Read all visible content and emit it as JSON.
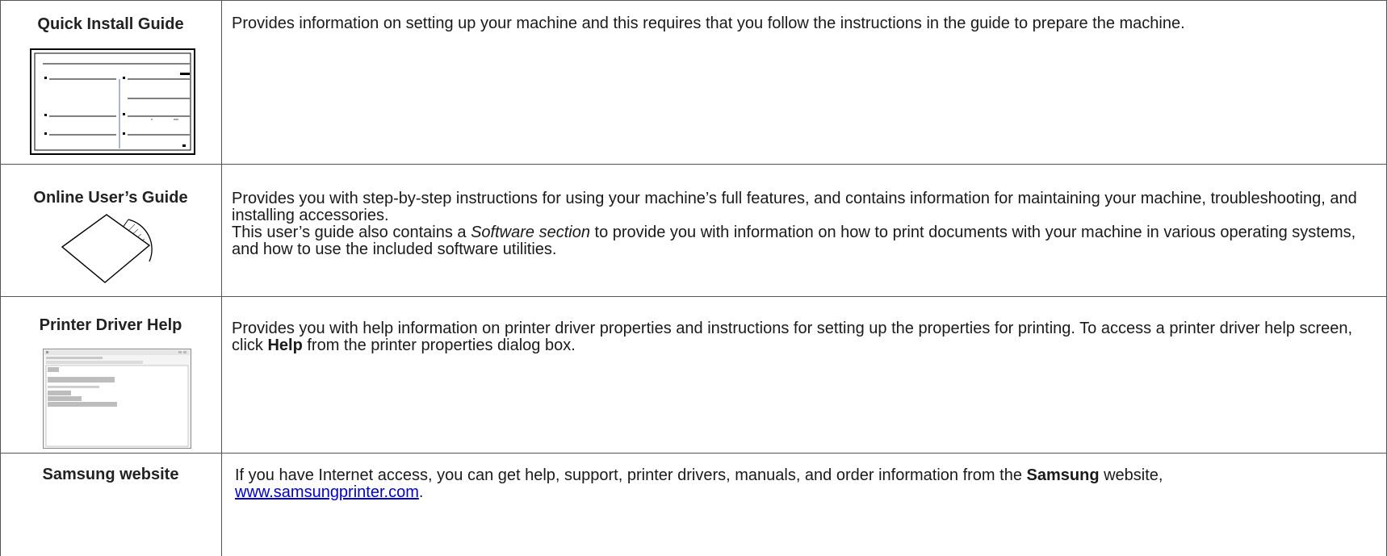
{
  "rows": [
    {
      "title": "Quick Install Guide",
      "description": "Provides information on setting up your machine and this requires that you follow the instructions in the guide to prepare the machine.",
      "thumbnail_icon": "quick-install-guide-thumbnail"
    },
    {
      "title": "Online User’s Guide",
      "description": "Provides you with step-by-step instructions for using your machine’s full features, and contains information for maintaining your machine, troubleshooting, and installing accessories.",
      "description2_pre": "This user’s guide also contains a ",
      "description2_em": "Software section",
      "description2_post": " to provide you with information on how to print documents with your machine in various operating systems, and how to use the included software utilities.",
      "thumbnail_icon": "cd-sleeve-icon"
    },
    {
      "title": "Printer Driver Help",
      "description_pre": "Provides you with help information on printer driver properties and instructions for setting up the properties for printing. To access a printer driver help screen, click ",
      "description_bold": "Help",
      "description_post": " from the printer properties dialog box.",
      "thumbnail_icon": "help-window-thumbnail"
    },
    {
      "title": "Samsung website",
      "description_pre": "If you have Internet access, you can get help, support, printer drivers, manuals, and order information from the ",
      "description_bold": "Samsung",
      "description_post": " website,",
      "link_text": "www.samsungprinter.com",
      "link_suffix": "."
    }
  ]
}
